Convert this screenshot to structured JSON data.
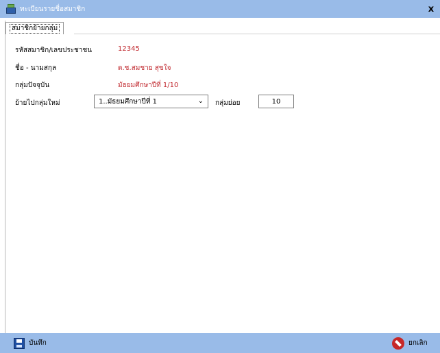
{
  "window": {
    "title": "ทะเบียนรายชื่อสมาชิก",
    "close_label": "x"
  },
  "tabs": [
    {
      "label": "สมาชิกย้ายกลุ่ม",
      "active": true
    }
  ],
  "form": {
    "member_id": {
      "label": "รหัสสมาชิก/เลขประชาชน",
      "value": "12345"
    },
    "full_name": {
      "label": "ชื่อ - นามสกุล",
      "value": "ด.ช.สมชาย สุขใจ"
    },
    "current_group": {
      "label": "กลุ่มปัจจุบัน",
      "value": "มัธยมศึกษาปีที่ 1/10"
    },
    "move_to": {
      "label": "ย้ายไปกลุ่มใหม่",
      "selected": "1..มัธยมศึกษาปีที่ 1"
    },
    "subgroup": {
      "label": "กลุ่มย่อย",
      "value": "10"
    }
  },
  "footer": {
    "save_label": "บันทึก",
    "cancel_label": "ยกเลิก"
  },
  "colors": {
    "titlebar": "#99bbe8",
    "value_text": "#c0282e"
  },
  "icons": {
    "app": "app-house-icon",
    "save": "floppy-disk-icon",
    "cancel": "no-entry-icon"
  }
}
